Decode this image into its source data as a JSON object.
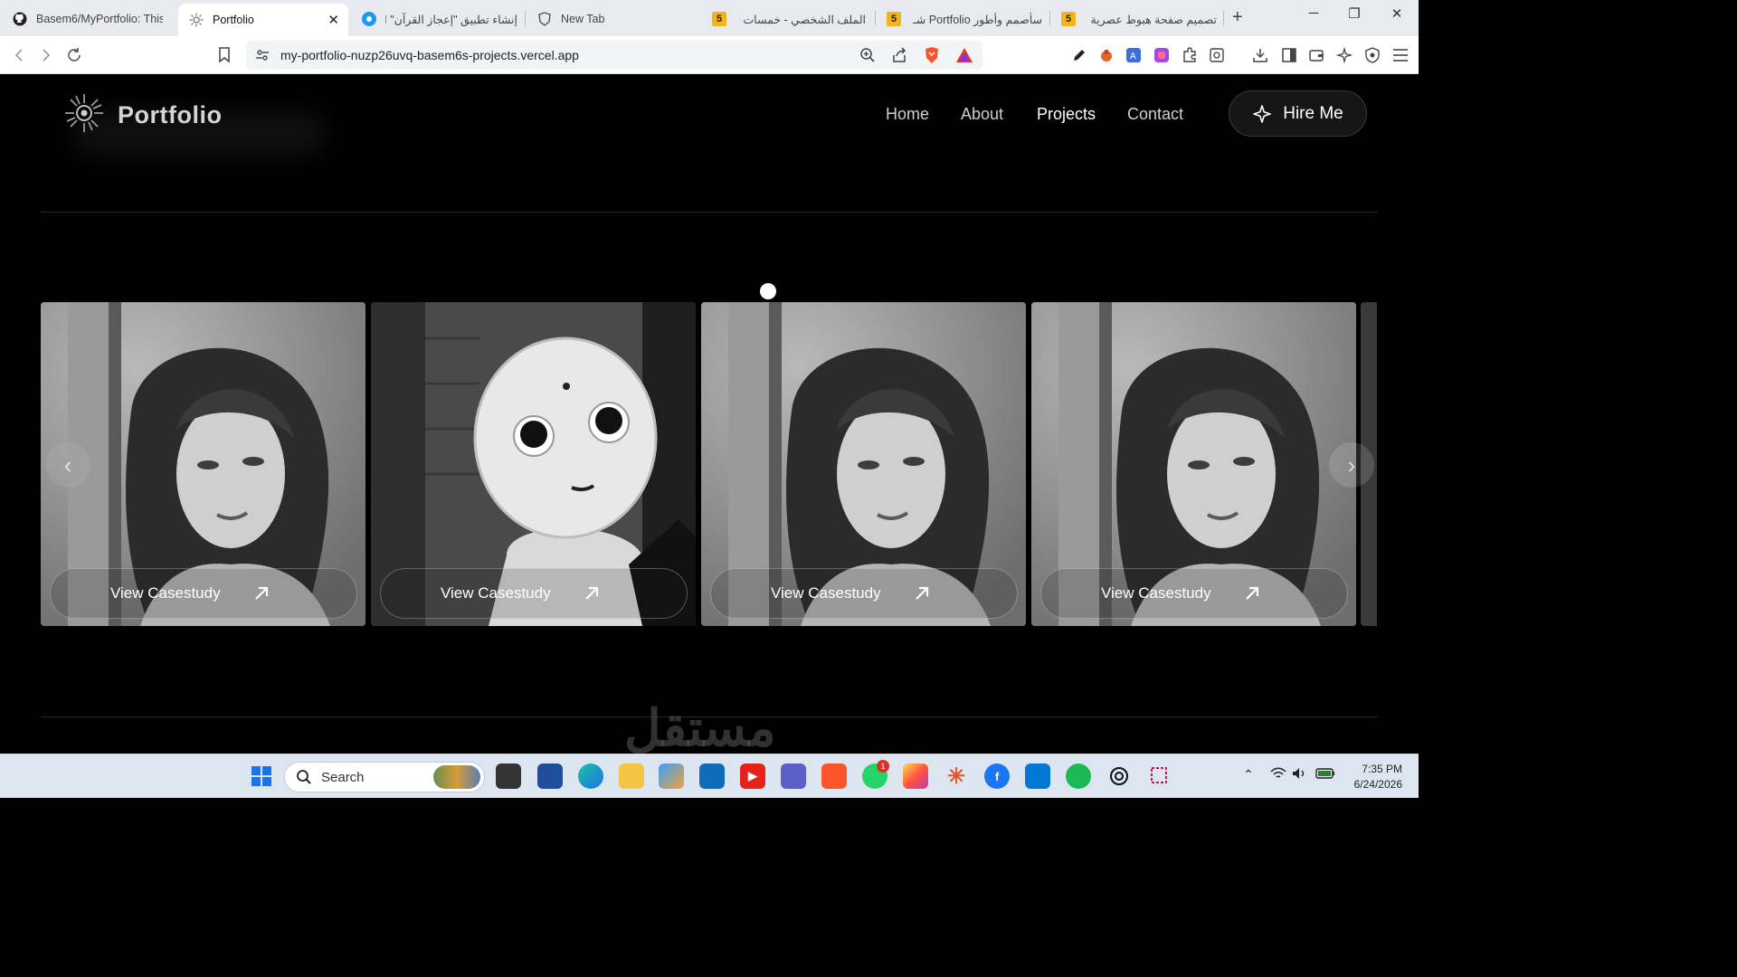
{
  "browser": {
    "tabs": [
      {
        "title": "Basem6/MyPortfolio: This",
        "icon": "github-icon"
      },
      {
        "title": "Portfolio",
        "icon": "portfolio-sun-icon",
        "active": true
      },
      {
        "title": "إنشاء تطبيق \"إعجاز القرآن\" الـ",
        "icon": "blue-circle-icon"
      },
      {
        "title": "New Tab",
        "icon": "brave-shield-icon"
      },
      {
        "title": "الملف الشخصي - خمسات",
        "icon": "khamsat-icon",
        "badge": "5"
      },
      {
        "title": "سأصمم وأطور Portfolio شـ",
        "icon": "khamsat-icon",
        "badge": "5"
      },
      {
        "title": "تصميم صفحة هبوط عصرية",
        "icon": "khamsat-icon",
        "badge": "5"
      }
    ],
    "url": "my-portfolio-nuzp26uvq-basem6s-projects.vercel.app",
    "new_tab_symbol": "+",
    "close_symbol": "✕"
  },
  "site": {
    "logo_text": "Portfolio",
    "nav": [
      {
        "label": "Home",
        "active": false
      },
      {
        "label": "About",
        "active": false
      },
      {
        "label": "Projects",
        "active": true
      },
      {
        "label": "Contact",
        "active": false
      }
    ],
    "hire_label": "Hire Me",
    "cards": [
      {
        "image": "woman-portrait",
        "cta": "View Casestudy"
      },
      {
        "image": "robot",
        "cta": "View Casestudy"
      },
      {
        "image": "woman-portrait",
        "cta": "View Casestudy"
      },
      {
        "image": "woman-portrait",
        "cta": "View Casestudy"
      }
    ],
    "prev_symbol": "‹",
    "next_symbol": "›"
  },
  "watermark": "مستقل",
  "taskbar": {
    "search_placeholder": "Search",
    "time": "7:35 PM",
    "date": "6/24/2026",
    "whatsapp_badge": "1"
  }
}
